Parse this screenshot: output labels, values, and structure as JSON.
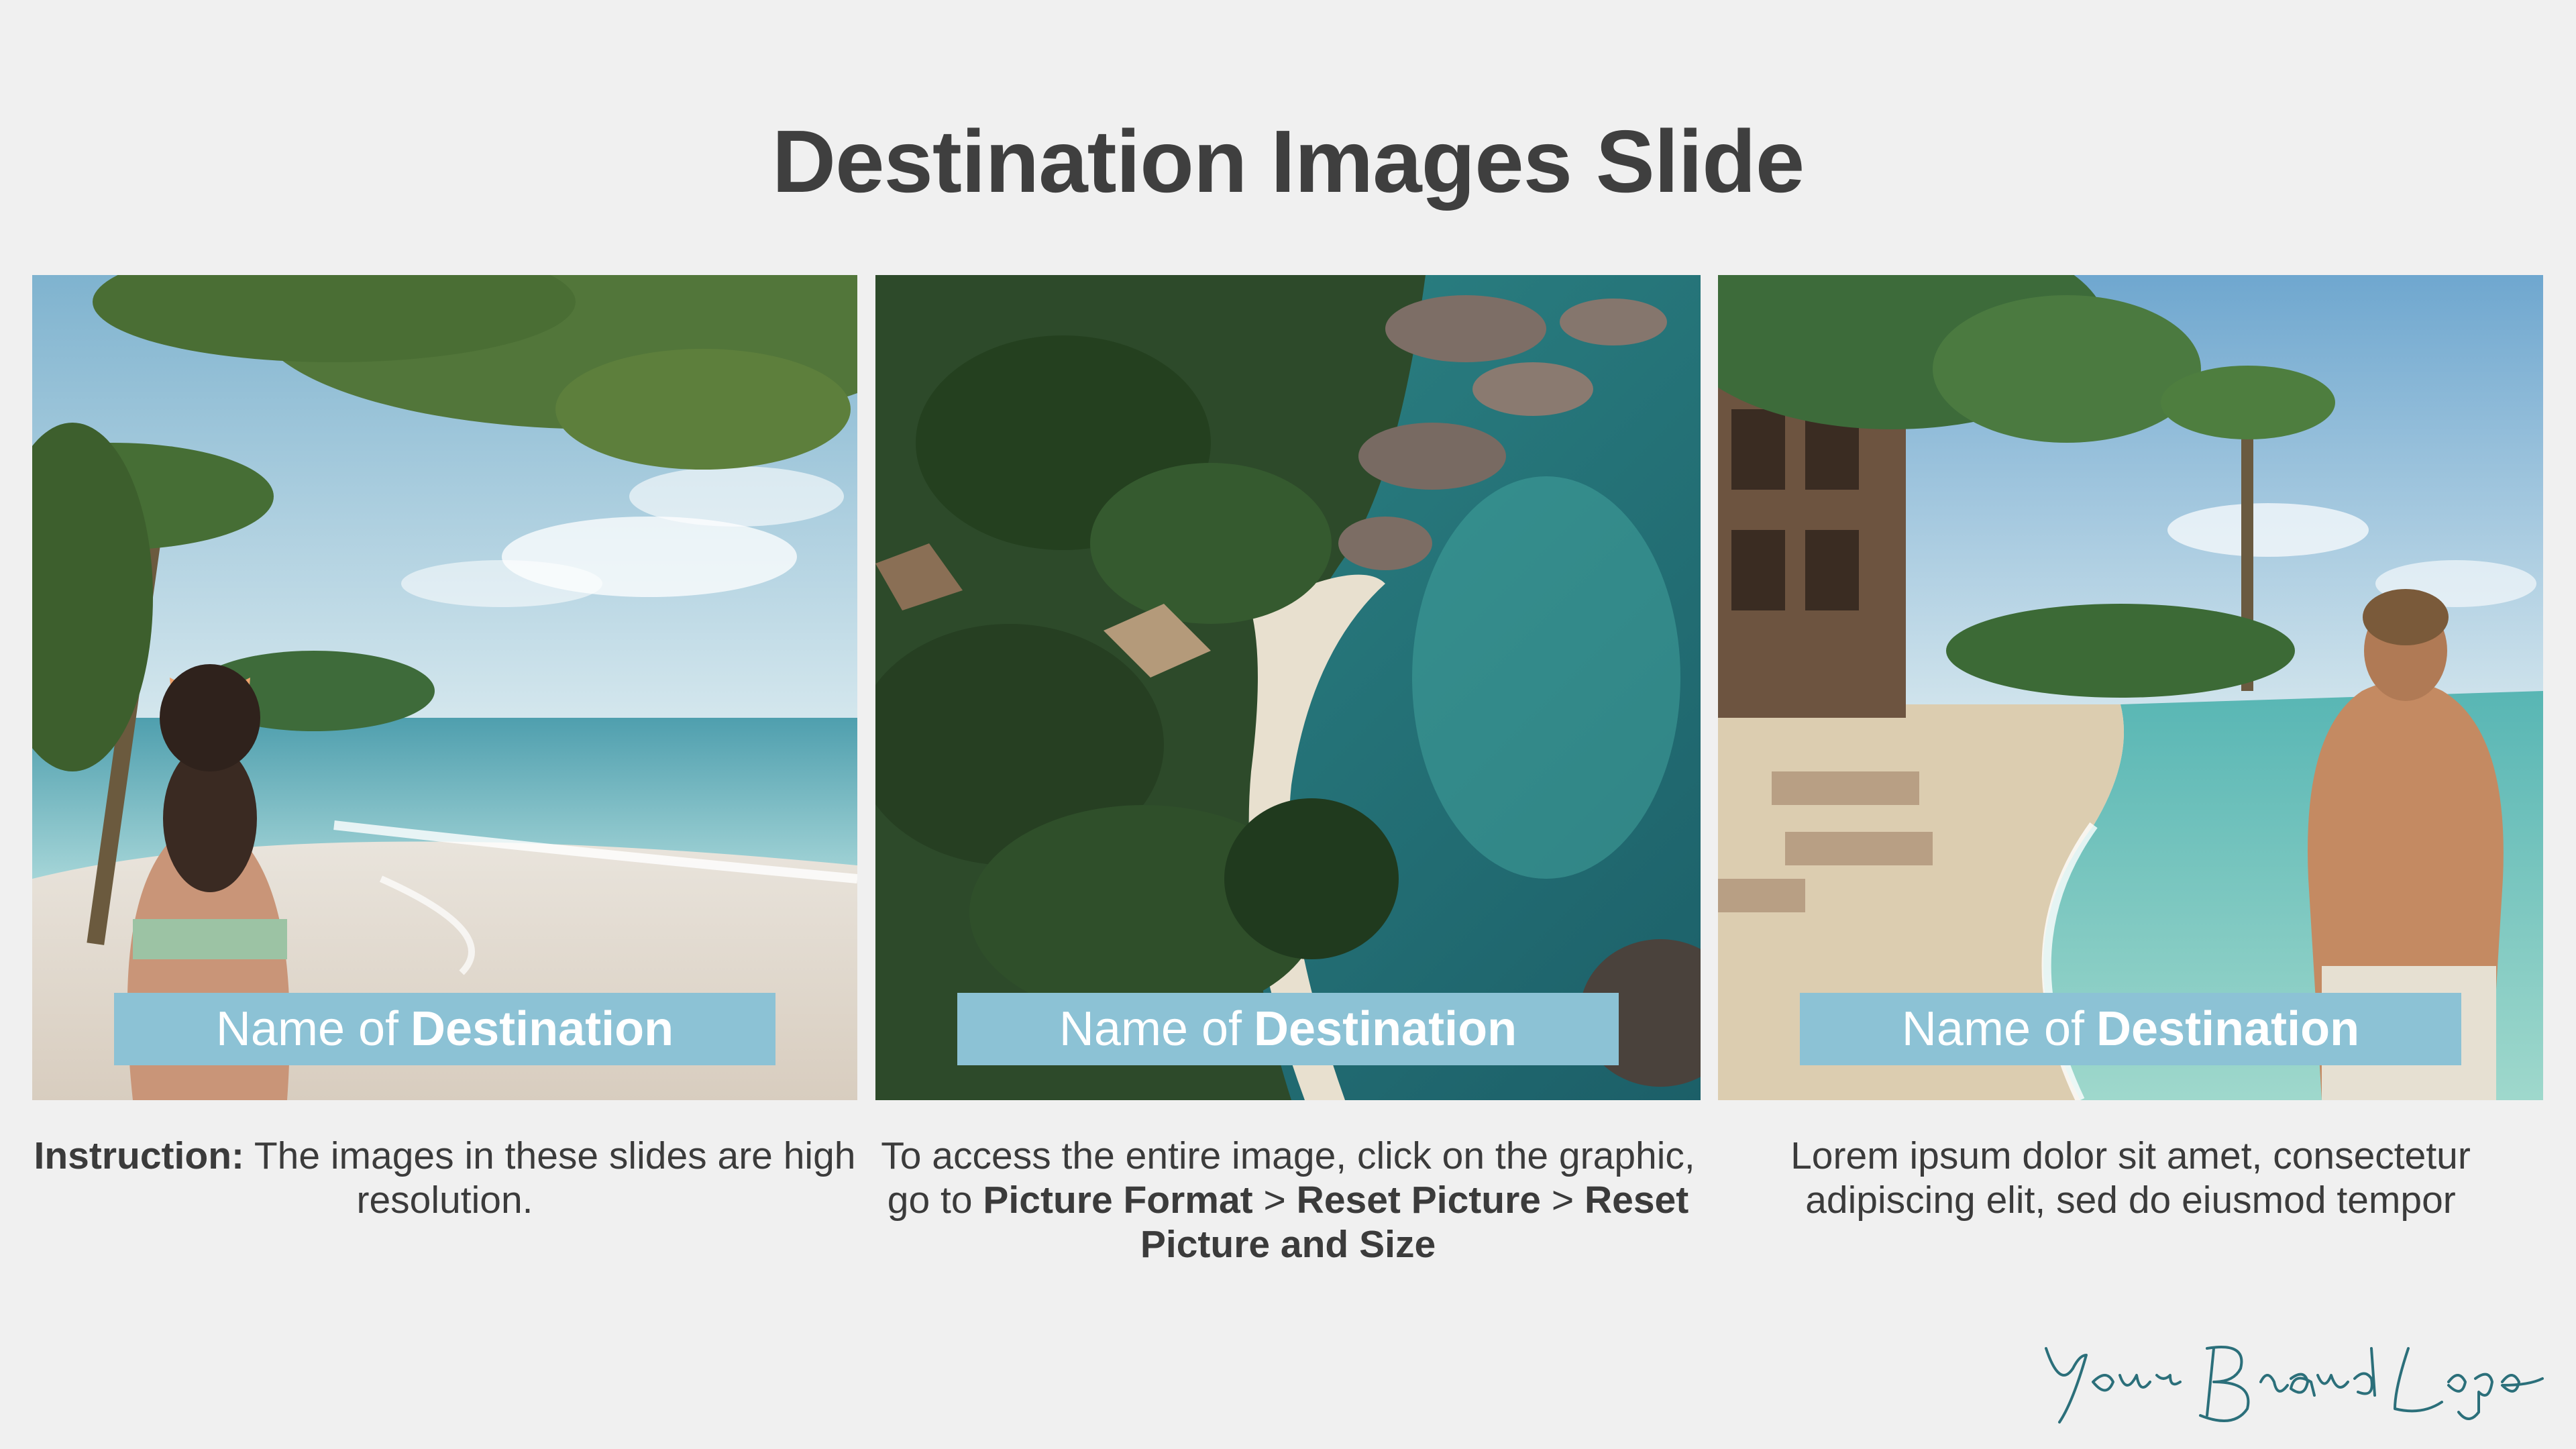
{
  "slide": {
    "title": "Destination Images Slide"
  },
  "cards": [
    {
      "image": "beach-woman-photo",
      "name_prefix": "Name of",
      "name_bold": "Destination"
    },
    {
      "image": "aerial-island-photo",
      "name_prefix": "Name of",
      "name_bold": "Destination"
    },
    {
      "image": "resort-man-photo",
      "name_prefix": "Name of",
      "name_bold": "Destination"
    }
  ],
  "captions": {
    "first": {
      "label": "Instruction:",
      "text": "The images in these slides are high resolution."
    },
    "second": {
      "intro": "To access the entire image, click on the graphic, go to",
      "step1": "Picture Format",
      "sep1": ">",
      "step2": "Reset Picture",
      "sep2": ">",
      "step3": "Reset Picture and Size"
    },
    "third": {
      "text": "Lorem ipsum dolor sit amet, consectetur adipiscing elit, sed do eiusmod tempor"
    }
  },
  "brand": {
    "logo_text": "Your Brand Logo",
    "color": "#2b6f7a"
  },
  "colors": {
    "background": "#f0f0f0",
    "name_bar": "#8cc2d5",
    "title": "#3f3f3f"
  }
}
